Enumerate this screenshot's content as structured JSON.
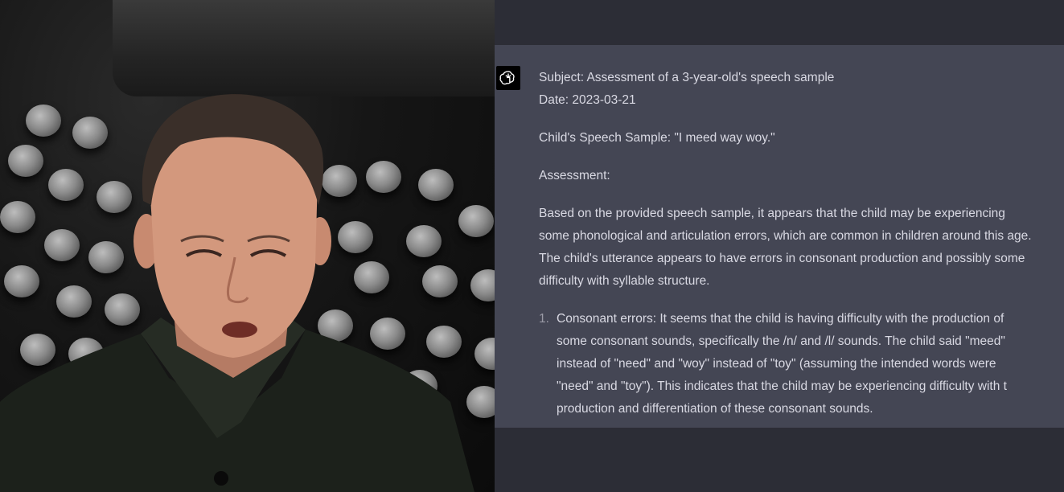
{
  "chat": {
    "subject_line": "Subject: Assessment of a 3-year-old's speech sample",
    "date_line": "Date: 2023-03-21",
    "sample_line": "Child's Speech Sample: \"I meed way woy.\"",
    "assessment_heading": "Assessment:",
    "paragraph_lines": [
      "Based on the provided speech sample, it appears that the child may be experiencing",
      "some phonological and articulation errors, which are common in children around this age.",
      "The child's utterance appears to have errors in consonant production and possibly some",
      "difficulty with syllable structure."
    ],
    "list_items": [
      {
        "number": "1.",
        "lines": [
          "Consonant errors: It seems that the child is having difficulty with the production of",
          "some consonant sounds, specifically the /n/ and /l/ sounds. The child said \"meed\"",
          "instead of \"need\" and \"woy\" instead of \"toy\" (assuming the intended words were",
          "\"need\" and \"toy\"). This indicates that the child may be experiencing difficulty with t",
          "production and differentiation of these consonant sounds."
        ]
      }
    ],
    "avatar_icon": "openai-logo-icon",
    "colors": {
      "message_bg": "#444654",
      "panel_bg": "#343541",
      "text": "#d9d9e3",
      "avatar_bg": "#000000"
    }
  },
  "webcam": {
    "icon": "webcam-feed"
  }
}
